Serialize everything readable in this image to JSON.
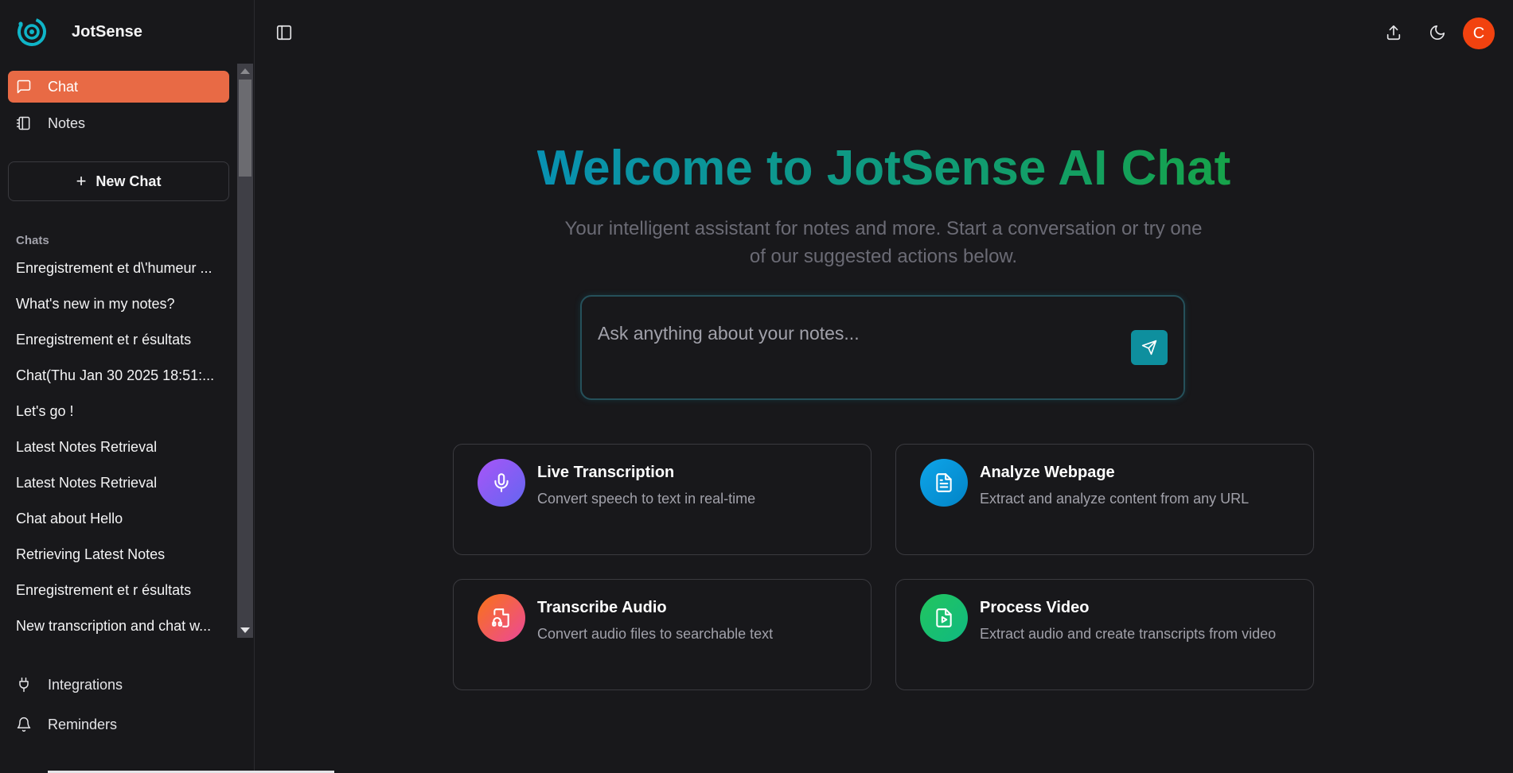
{
  "app": {
    "name": "JotSense"
  },
  "nav": {
    "chat": "Chat",
    "notes": "Notes",
    "new_chat": "New Chat",
    "integrations": "Integrations",
    "reminders": "Reminders"
  },
  "chats": {
    "title": "Chats",
    "items": [
      "Enregistrement et d\\'humeur ...",
      "What's new in my notes?",
      "Enregistrement et r ésultats",
      "Chat(Thu Jan 30 2025 18:51:...",
      "Let's go !",
      "Latest Notes Retrieval",
      "Latest Notes Retrieval",
      "Chat about Hello",
      "Retrieving Latest Notes",
      "Enregistrement et r ésultats",
      "New transcription and chat w..."
    ]
  },
  "header": {
    "avatar_initial": "C"
  },
  "hero": {
    "title": "Welcome to JotSense AI Chat",
    "subtitle": "Your intelligent assistant for notes and more. Start a conversation or try one of our suggested actions below."
  },
  "prompt": {
    "placeholder": "Ask anything about your notes..."
  },
  "actions": [
    {
      "title": "Live Transcription",
      "description": "Convert speech to text in real-time",
      "icon": "mic-icon",
      "color": "#8b5cf6"
    },
    {
      "title": "Analyze Webpage",
      "description": "Extract and analyze content from any URL",
      "icon": "file-text-icon",
      "color": "#0ea5e9"
    },
    {
      "title": "Transcribe Audio",
      "description": "Convert audio files to searchable text",
      "icon": "file-audio-icon",
      "color": "#f97316"
    },
    {
      "title": "Process Video",
      "description": "Extract audio and create transcripts from video",
      "icon": "file-video-icon",
      "color": "#22c55e"
    }
  ],
  "colors": {
    "accent": "#e86a45",
    "avatar": "#f2420f",
    "send": "#0e8f9e",
    "title_gradient_start": "#0891b2",
    "title_gradient_end": "#16a34a"
  }
}
